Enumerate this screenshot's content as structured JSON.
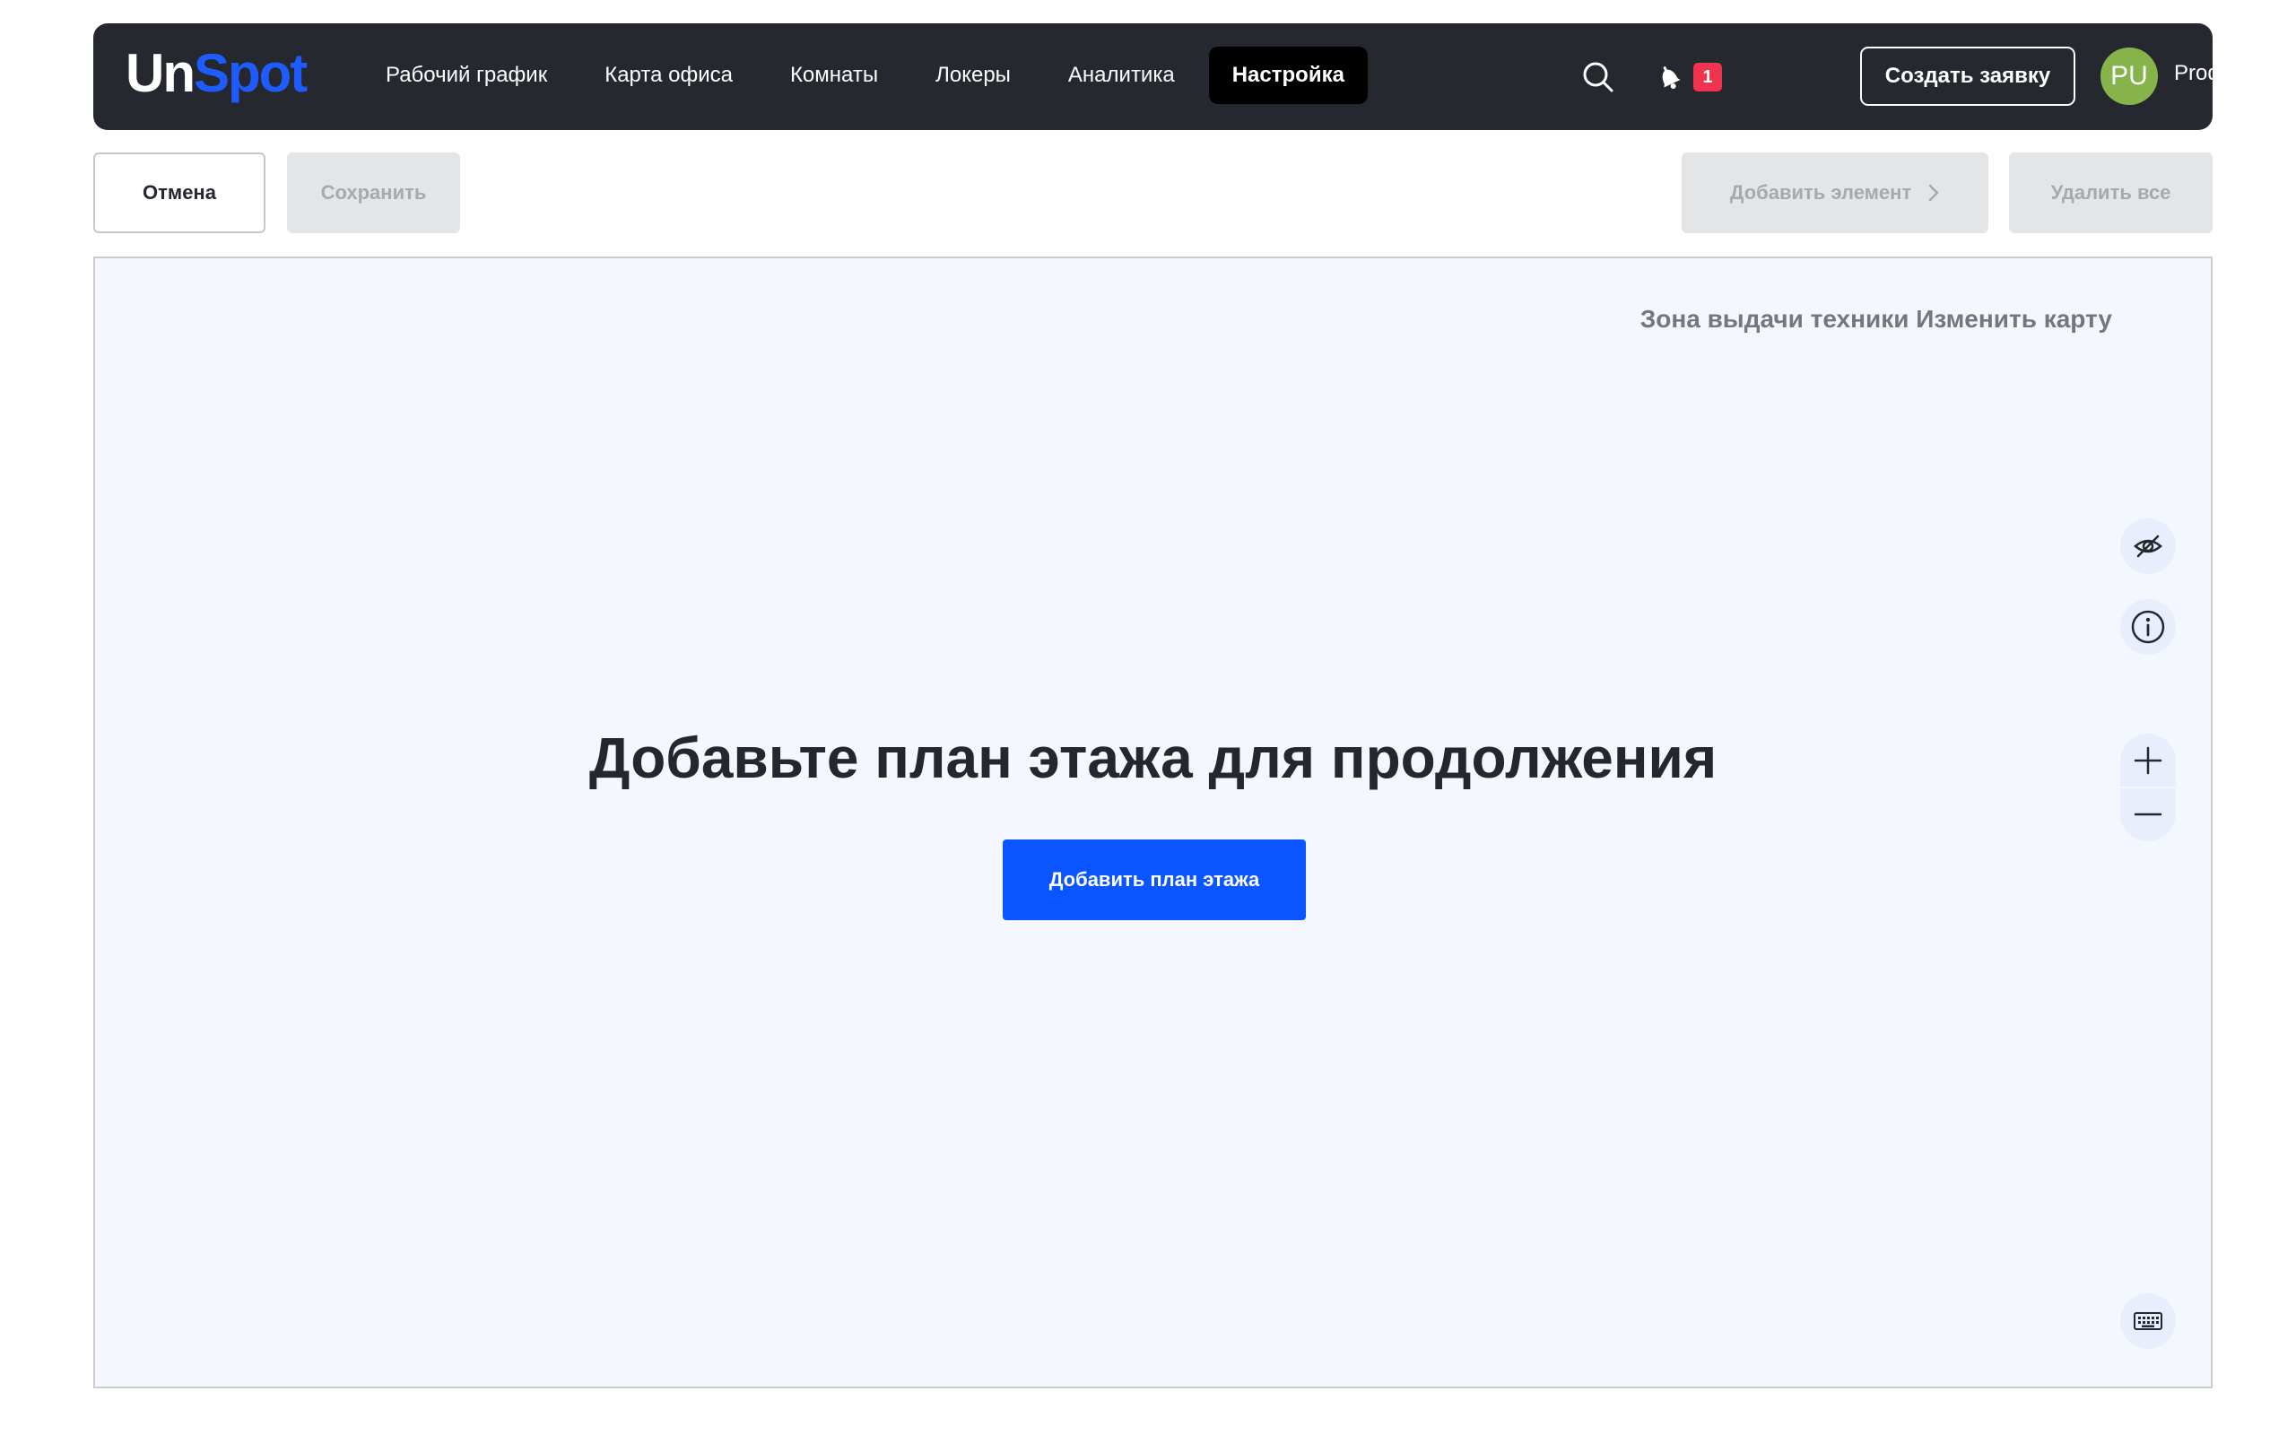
{
  "app": {
    "logo_part1": "Un",
    "logo_part2": "Spot"
  },
  "nav": {
    "items": [
      {
        "label": "Рабочий график"
      },
      {
        "label": "Карта офиса"
      },
      {
        "label": "Комнаты"
      },
      {
        "label": "Локеры"
      },
      {
        "label": "Аналитика"
      },
      {
        "label": "Настройка",
        "active": true
      }
    ]
  },
  "header": {
    "notification_count": "1",
    "create_request_label": "Создать заявку",
    "user_initials": "PU",
    "user_name": "Product"
  },
  "toolbar": {
    "cancel_label": "Отмена",
    "save_label": "Сохранить",
    "add_element_label": "Добавить элемент",
    "delete_all_label": "Удалить все"
  },
  "canvas": {
    "zone_title": "Зона выдачи техники Изменить карту",
    "empty_heading": "Добавьте план этажа для продолжения",
    "add_plan_label": "Добавить план этажа"
  },
  "icons": {
    "search": "search-icon",
    "notifications": "bell-icon",
    "chevron": "chevron-right-icon",
    "visibility": "eye-off-icon",
    "info": "info-icon",
    "zoom_in": "plus-icon",
    "zoom_out": "minus-icon",
    "keyboard": "keyboard-icon"
  },
  "colors": {
    "topbar_bg": "#25282e",
    "brand_blue": "#1f5cff",
    "primary_button": "#0a55ff",
    "badge_red": "#f0344f",
    "avatar_green": "#86b34a",
    "canvas_bg": "#f4f7fd"
  }
}
